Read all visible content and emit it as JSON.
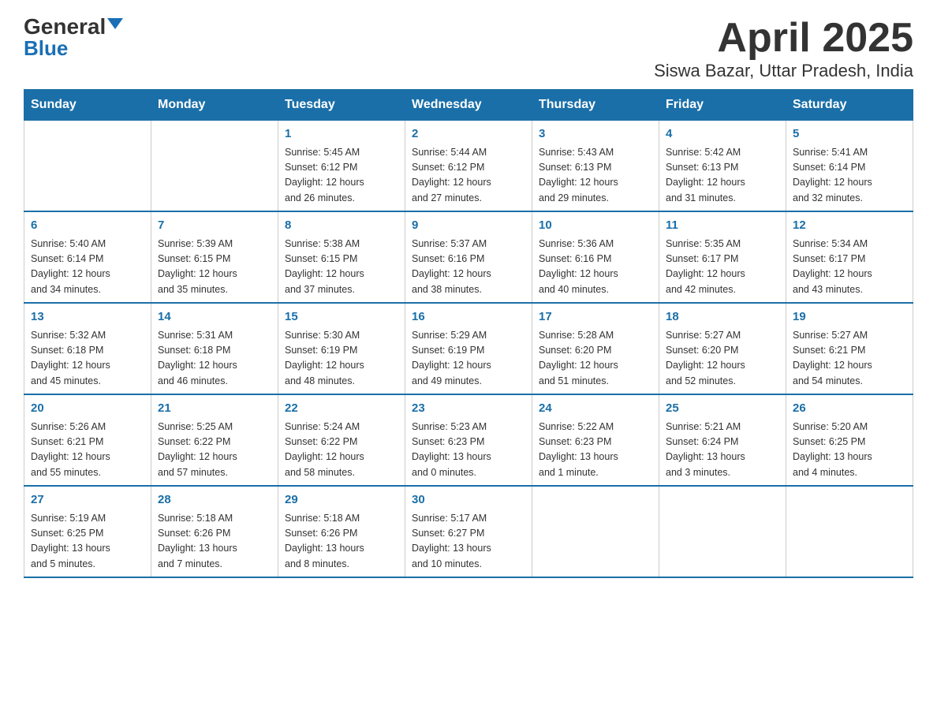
{
  "header": {
    "logo_main": "General",
    "logo_sub": "Blue",
    "month": "April 2025",
    "location": "Siswa Bazar, Uttar Pradesh, India"
  },
  "days_of_week": [
    "Sunday",
    "Monday",
    "Tuesday",
    "Wednesday",
    "Thursday",
    "Friday",
    "Saturday"
  ],
  "weeks": [
    [
      {
        "day": "",
        "info": ""
      },
      {
        "day": "",
        "info": ""
      },
      {
        "day": "1",
        "info": "Sunrise: 5:45 AM\nSunset: 6:12 PM\nDaylight: 12 hours\nand 26 minutes."
      },
      {
        "day": "2",
        "info": "Sunrise: 5:44 AM\nSunset: 6:12 PM\nDaylight: 12 hours\nand 27 minutes."
      },
      {
        "day": "3",
        "info": "Sunrise: 5:43 AM\nSunset: 6:13 PM\nDaylight: 12 hours\nand 29 minutes."
      },
      {
        "day": "4",
        "info": "Sunrise: 5:42 AM\nSunset: 6:13 PM\nDaylight: 12 hours\nand 31 minutes."
      },
      {
        "day": "5",
        "info": "Sunrise: 5:41 AM\nSunset: 6:14 PM\nDaylight: 12 hours\nand 32 minutes."
      }
    ],
    [
      {
        "day": "6",
        "info": "Sunrise: 5:40 AM\nSunset: 6:14 PM\nDaylight: 12 hours\nand 34 minutes."
      },
      {
        "day": "7",
        "info": "Sunrise: 5:39 AM\nSunset: 6:15 PM\nDaylight: 12 hours\nand 35 minutes."
      },
      {
        "day": "8",
        "info": "Sunrise: 5:38 AM\nSunset: 6:15 PM\nDaylight: 12 hours\nand 37 minutes."
      },
      {
        "day": "9",
        "info": "Sunrise: 5:37 AM\nSunset: 6:16 PM\nDaylight: 12 hours\nand 38 minutes."
      },
      {
        "day": "10",
        "info": "Sunrise: 5:36 AM\nSunset: 6:16 PM\nDaylight: 12 hours\nand 40 minutes."
      },
      {
        "day": "11",
        "info": "Sunrise: 5:35 AM\nSunset: 6:17 PM\nDaylight: 12 hours\nand 42 minutes."
      },
      {
        "day": "12",
        "info": "Sunrise: 5:34 AM\nSunset: 6:17 PM\nDaylight: 12 hours\nand 43 minutes."
      }
    ],
    [
      {
        "day": "13",
        "info": "Sunrise: 5:32 AM\nSunset: 6:18 PM\nDaylight: 12 hours\nand 45 minutes."
      },
      {
        "day": "14",
        "info": "Sunrise: 5:31 AM\nSunset: 6:18 PM\nDaylight: 12 hours\nand 46 minutes."
      },
      {
        "day": "15",
        "info": "Sunrise: 5:30 AM\nSunset: 6:19 PM\nDaylight: 12 hours\nand 48 minutes."
      },
      {
        "day": "16",
        "info": "Sunrise: 5:29 AM\nSunset: 6:19 PM\nDaylight: 12 hours\nand 49 minutes."
      },
      {
        "day": "17",
        "info": "Sunrise: 5:28 AM\nSunset: 6:20 PM\nDaylight: 12 hours\nand 51 minutes."
      },
      {
        "day": "18",
        "info": "Sunrise: 5:27 AM\nSunset: 6:20 PM\nDaylight: 12 hours\nand 52 minutes."
      },
      {
        "day": "19",
        "info": "Sunrise: 5:27 AM\nSunset: 6:21 PM\nDaylight: 12 hours\nand 54 minutes."
      }
    ],
    [
      {
        "day": "20",
        "info": "Sunrise: 5:26 AM\nSunset: 6:21 PM\nDaylight: 12 hours\nand 55 minutes."
      },
      {
        "day": "21",
        "info": "Sunrise: 5:25 AM\nSunset: 6:22 PM\nDaylight: 12 hours\nand 57 minutes."
      },
      {
        "day": "22",
        "info": "Sunrise: 5:24 AM\nSunset: 6:22 PM\nDaylight: 12 hours\nand 58 minutes."
      },
      {
        "day": "23",
        "info": "Sunrise: 5:23 AM\nSunset: 6:23 PM\nDaylight: 13 hours\nand 0 minutes."
      },
      {
        "day": "24",
        "info": "Sunrise: 5:22 AM\nSunset: 6:23 PM\nDaylight: 13 hours\nand 1 minute."
      },
      {
        "day": "25",
        "info": "Sunrise: 5:21 AM\nSunset: 6:24 PM\nDaylight: 13 hours\nand 3 minutes."
      },
      {
        "day": "26",
        "info": "Sunrise: 5:20 AM\nSunset: 6:25 PM\nDaylight: 13 hours\nand 4 minutes."
      }
    ],
    [
      {
        "day": "27",
        "info": "Sunrise: 5:19 AM\nSunset: 6:25 PM\nDaylight: 13 hours\nand 5 minutes."
      },
      {
        "day": "28",
        "info": "Sunrise: 5:18 AM\nSunset: 6:26 PM\nDaylight: 13 hours\nand 7 minutes."
      },
      {
        "day": "29",
        "info": "Sunrise: 5:18 AM\nSunset: 6:26 PM\nDaylight: 13 hours\nand 8 minutes."
      },
      {
        "day": "30",
        "info": "Sunrise: 5:17 AM\nSunset: 6:27 PM\nDaylight: 13 hours\nand 10 minutes."
      },
      {
        "day": "",
        "info": ""
      },
      {
        "day": "",
        "info": ""
      },
      {
        "day": "",
        "info": ""
      }
    ]
  ]
}
